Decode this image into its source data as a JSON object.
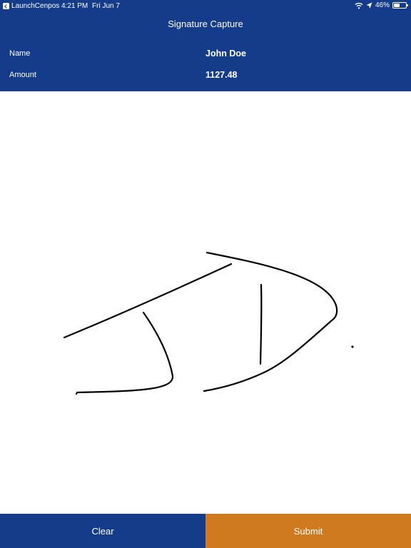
{
  "status_bar": {
    "back_app": "LaunchCenpos",
    "time": "4:21 PM",
    "date": "Fri Jun 7",
    "battery": "46%",
    "icons": [
      "back-icon",
      "wifi-icon",
      "location-icon",
      "battery-icon"
    ]
  },
  "header": {
    "title": "Signature Capture",
    "name_label": "Name",
    "name_value": "John Doe",
    "amount_label": "Amount",
    "amount_value": "1127.48"
  },
  "footer": {
    "clear_label": "Clear",
    "submit_label": "Submit"
  },
  "colors": {
    "header_bg": "#153c8a",
    "clear_bg": "#153c8a",
    "submit_bg": "#d07a1f",
    "ink": "#000000"
  }
}
